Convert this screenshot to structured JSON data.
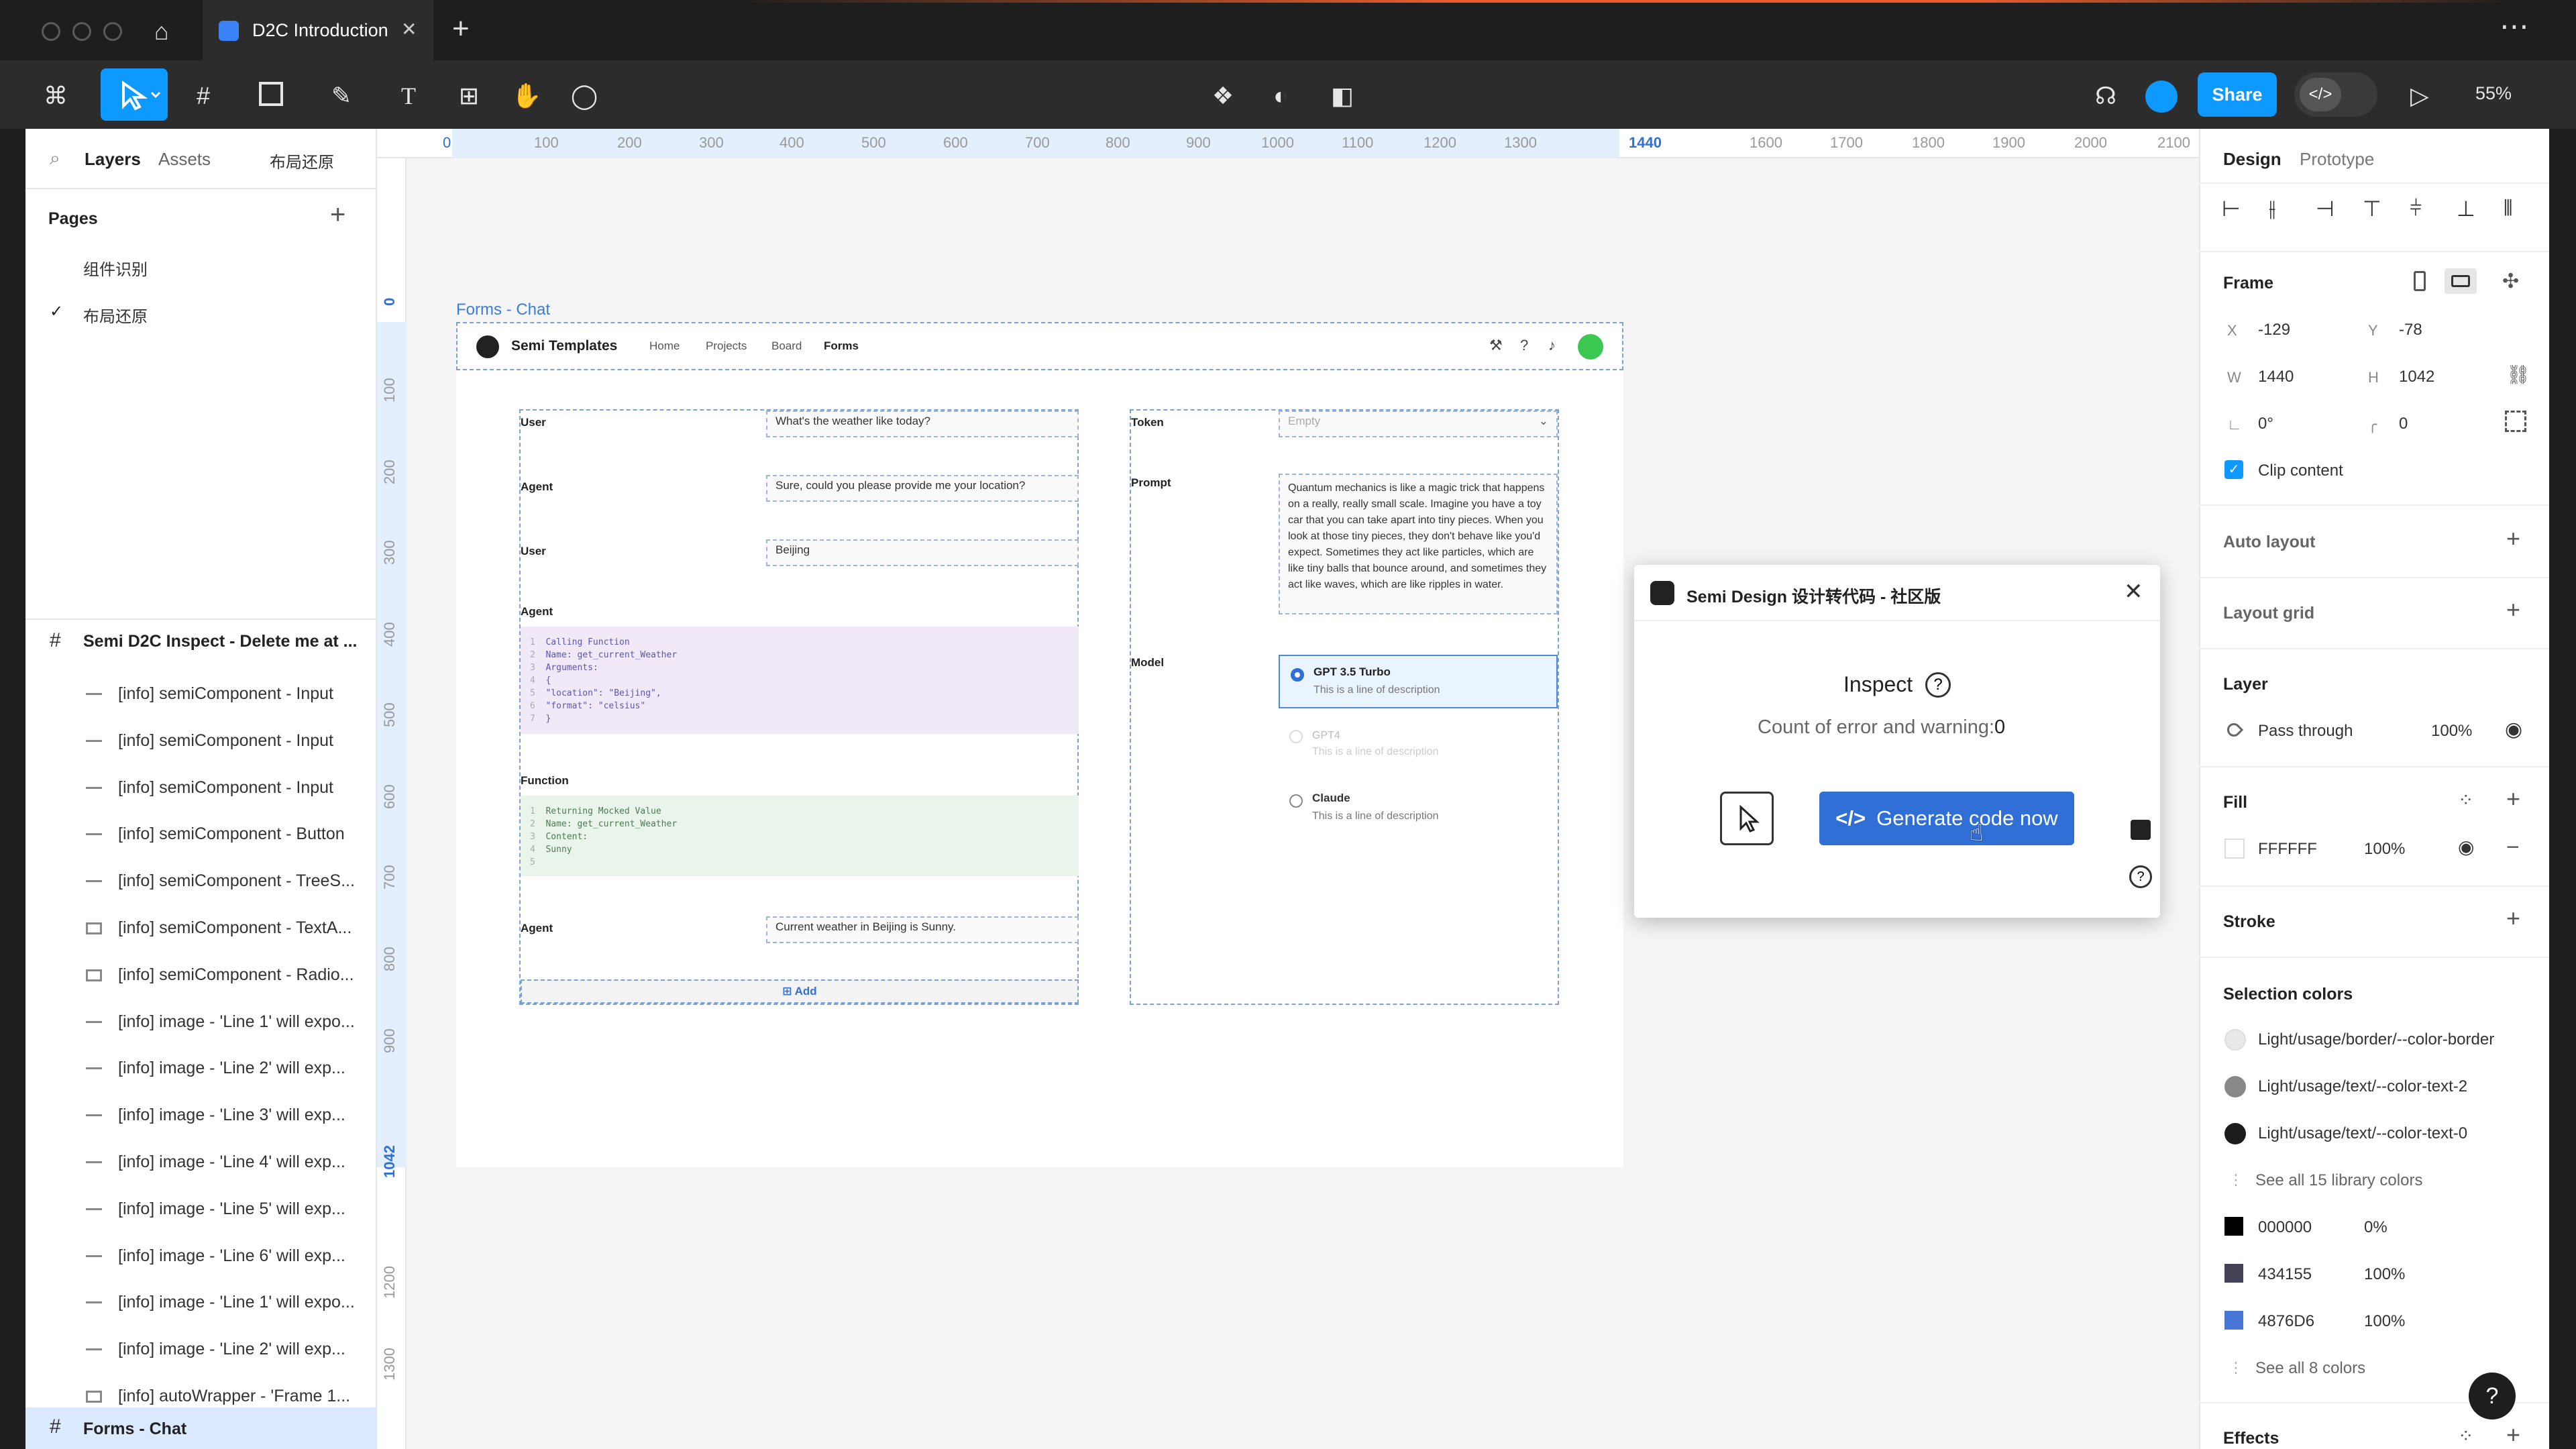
{
  "tabbar": {
    "tab_title": "D2C Introduction",
    "close": "✕",
    "add": "+",
    "more": "⋯"
  },
  "toolbar": {
    "share": "Share",
    "zoom": "55%"
  },
  "left": {
    "tabs": {
      "layers": "Layers",
      "assets": "Assets",
      "page_name": "布局还原"
    },
    "pages_title": "Pages",
    "pages": [
      "组件识别",
      "布局还原"
    ],
    "inspect_group": "Semi D2C Inspect - Delete me at ...",
    "layers": [
      "[info] semiComponent - Input",
      "[info] semiComponent - Input",
      "[info] semiComponent - Input",
      "[info] semiComponent - Button",
      "[info] semiComponent - TreeS...",
      "[info] semiComponent - TextA...",
      "[info] semiComponent - Radio...",
      "[info] image - 'Line 1' will expo...",
      "[info] image - 'Line 2' will exp...",
      "[info] image - 'Line 3' will exp...",
      "[info] image - 'Line 4' will exp...",
      "[info] image - 'Line 5' will exp...",
      "[info] image - 'Line 6' will exp...",
      "[info] image - 'Line 1' will expo...",
      "[info] image - 'Line 2' will exp...",
      "[info] autoWrapper - 'Frame 1..."
    ],
    "bottom_frame": "Forms - Chat"
  },
  "ruler": {
    "h": [
      "0",
      "100",
      "200",
      "300",
      "400",
      "500",
      "600",
      "700",
      "800",
      "900",
      "1000",
      "1100",
      "1200",
      "1300",
      "1440",
      "1600",
      "1700",
      "1800",
      "1900",
      "2000",
      "2100"
    ],
    "v": [
      "0",
      "100",
      "200",
      "300",
      "400",
      "500",
      "600",
      "700",
      "800",
      "900",
      "1042",
      "1200",
      "1300"
    ]
  },
  "frame": {
    "label": "Forms - Chat",
    "brand": "Semi Templates",
    "nav": [
      "Home",
      "Projects",
      "Board",
      "Forms"
    ],
    "rows": {
      "user1_label": "User",
      "user1_value": "What's the weather like today?",
      "agent1_label": "Agent",
      "agent1_value": "Sure, could you please provide me your location?",
      "user2_label": "User",
      "user2_value": "Beijing",
      "agent2_label": "Agent",
      "function_label": "Function",
      "agent3_label": "Agent",
      "agent3_value": "Current weather in Beijing is Sunny.",
      "add": "Add"
    },
    "code1": [
      "Calling Function",
      "Name: get_current_Weather",
      "Arguments:",
      "{",
      "\"location\": \"Beijing\",",
      "\"format\": \"celsius\"",
      "}"
    ],
    "code2": [
      "Returning Mocked Value",
      "Name: get_current_Weather",
      "Content:",
      "Sunny",
      ""
    ],
    "right": {
      "token_label": "Token",
      "token_placeholder": "Empty",
      "prompt_label": "Prompt",
      "prompt_text": "Quantum mechanics is like a magic trick that happens on a really, really small scale. Imagine you have a toy car that you can take apart into tiny pieces. When you look at those tiny pieces, they don't behave like you'd expect. Sometimes they act like particles, which are like tiny balls that bounce around, and sometimes they act like waves, which are like ripples in water.",
      "model_label": "Model",
      "models": [
        {
          "name": "GPT 3.5 Turbo",
          "desc": "This is a line of description"
        },
        {
          "name": "GPT4",
          "desc": "This is a line of description"
        },
        {
          "name": "Claude",
          "desc": "This is a line of description"
        }
      ]
    }
  },
  "dialog": {
    "title": "Semi Design 设计转代码 - 社区版",
    "inspect": "Inspect",
    "count": "Count of error and warning:",
    "count_value": "0",
    "generate": "Generate code now"
  },
  "right": {
    "tabs": {
      "design": "Design",
      "prototype": "Prototype"
    },
    "frame": "Frame",
    "x_label": "X",
    "x": "-129",
    "y_label": "Y",
    "y": "-78",
    "w_label": "W",
    "w": "1440",
    "h_label": "H",
    "h": "1042",
    "rotation": "0°",
    "radius": "0",
    "clip": "Clip content",
    "auto_layout": "Auto layout",
    "layout_grid": "Layout grid",
    "layer": "Layer",
    "blend": "Pass through",
    "opacity": "100%",
    "fill": "Fill",
    "fill_hex": "FFFFFF",
    "fill_opacity": "100%",
    "stroke": "Stroke",
    "selection_colors": "Selection colors",
    "lib_colors": [
      "Light/usage/border/--color-border",
      "Light/usage/text/--color-text-2",
      "Light/usage/text/--color-text-0"
    ],
    "see_all_lib": "See all 15 library colors",
    "colors": [
      {
        "hex": "000000",
        "pct": "0%"
      },
      {
        "hex": "434155",
        "pct": "100%"
      },
      {
        "hex": "4876D6",
        "pct": "100%"
      }
    ],
    "see_all": "See all 8 colors",
    "effects": "Effects",
    "help": "?"
  }
}
